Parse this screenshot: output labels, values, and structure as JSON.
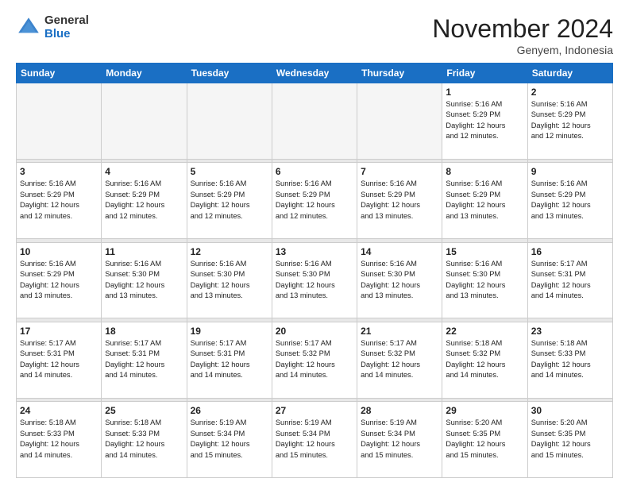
{
  "logo": {
    "general": "General",
    "blue": "Blue"
  },
  "title": "November 2024",
  "location": "Genyem, Indonesia",
  "weekdays": [
    "Sunday",
    "Monday",
    "Tuesday",
    "Wednesday",
    "Thursday",
    "Friday",
    "Saturday"
  ],
  "weeks": [
    [
      {
        "day": "",
        "info": ""
      },
      {
        "day": "",
        "info": ""
      },
      {
        "day": "",
        "info": ""
      },
      {
        "day": "",
        "info": ""
      },
      {
        "day": "",
        "info": ""
      },
      {
        "day": "1",
        "info": "Sunrise: 5:16 AM\nSunset: 5:29 PM\nDaylight: 12 hours\nand 12 minutes."
      },
      {
        "day": "2",
        "info": "Sunrise: 5:16 AM\nSunset: 5:29 PM\nDaylight: 12 hours\nand 12 minutes."
      }
    ],
    [
      {
        "day": "3",
        "info": "Sunrise: 5:16 AM\nSunset: 5:29 PM\nDaylight: 12 hours\nand 12 minutes."
      },
      {
        "day": "4",
        "info": "Sunrise: 5:16 AM\nSunset: 5:29 PM\nDaylight: 12 hours\nand 12 minutes."
      },
      {
        "day": "5",
        "info": "Sunrise: 5:16 AM\nSunset: 5:29 PM\nDaylight: 12 hours\nand 12 minutes."
      },
      {
        "day": "6",
        "info": "Sunrise: 5:16 AM\nSunset: 5:29 PM\nDaylight: 12 hours\nand 12 minutes."
      },
      {
        "day": "7",
        "info": "Sunrise: 5:16 AM\nSunset: 5:29 PM\nDaylight: 12 hours\nand 13 minutes."
      },
      {
        "day": "8",
        "info": "Sunrise: 5:16 AM\nSunset: 5:29 PM\nDaylight: 12 hours\nand 13 minutes."
      },
      {
        "day": "9",
        "info": "Sunrise: 5:16 AM\nSunset: 5:29 PM\nDaylight: 12 hours\nand 13 minutes."
      }
    ],
    [
      {
        "day": "10",
        "info": "Sunrise: 5:16 AM\nSunset: 5:29 PM\nDaylight: 12 hours\nand 13 minutes."
      },
      {
        "day": "11",
        "info": "Sunrise: 5:16 AM\nSunset: 5:30 PM\nDaylight: 12 hours\nand 13 minutes."
      },
      {
        "day": "12",
        "info": "Sunrise: 5:16 AM\nSunset: 5:30 PM\nDaylight: 12 hours\nand 13 minutes."
      },
      {
        "day": "13",
        "info": "Sunrise: 5:16 AM\nSunset: 5:30 PM\nDaylight: 12 hours\nand 13 minutes."
      },
      {
        "day": "14",
        "info": "Sunrise: 5:16 AM\nSunset: 5:30 PM\nDaylight: 12 hours\nand 13 minutes."
      },
      {
        "day": "15",
        "info": "Sunrise: 5:16 AM\nSunset: 5:30 PM\nDaylight: 12 hours\nand 13 minutes."
      },
      {
        "day": "16",
        "info": "Sunrise: 5:17 AM\nSunset: 5:31 PM\nDaylight: 12 hours\nand 14 minutes."
      }
    ],
    [
      {
        "day": "17",
        "info": "Sunrise: 5:17 AM\nSunset: 5:31 PM\nDaylight: 12 hours\nand 14 minutes."
      },
      {
        "day": "18",
        "info": "Sunrise: 5:17 AM\nSunset: 5:31 PM\nDaylight: 12 hours\nand 14 minutes."
      },
      {
        "day": "19",
        "info": "Sunrise: 5:17 AM\nSunset: 5:31 PM\nDaylight: 12 hours\nand 14 minutes."
      },
      {
        "day": "20",
        "info": "Sunrise: 5:17 AM\nSunset: 5:32 PM\nDaylight: 12 hours\nand 14 minutes."
      },
      {
        "day": "21",
        "info": "Sunrise: 5:17 AM\nSunset: 5:32 PM\nDaylight: 12 hours\nand 14 minutes."
      },
      {
        "day": "22",
        "info": "Sunrise: 5:18 AM\nSunset: 5:32 PM\nDaylight: 12 hours\nand 14 minutes."
      },
      {
        "day": "23",
        "info": "Sunrise: 5:18 AM\nSunset: 5:33 PM\nDaylight: 12 hours\nand 14 minutes."
      }
    ],
    [
      {
        "day": "24",
        "info": "Sunrise: 5:18 AM\nSunset: 5:33 PM\nDaylight: 12 hours\nand 14 minutes."
      },
      {
        "day": "25",
        "info": "Sunrise: 5:18 AM\nSunset: 5:33 PM\nDaylight: 12 hours\nand 14 minutes."
      },
      {
        "day": "26",
        "info": "Sunrise: 5:19 AM\nSunset: 5:34 PM\nDaylight: 12 hours\nand 15 minutes."
      },
      {
        "day": "27",
        "info": "Sunrise: 5:19 AM\nSunset: 5:34 PM\nDaylight: 12 hours\nand 15 minutes."
      },
      {
        "day": "28",
        "info": "Sunrise: 5:19 AM\nSunset: 5:34 PM\nDaylight: 12 hours\nand 15 minutes."
      },
      {
        "day": "29",
        "info": "Sunrise: 5:20 AM\nSunset: 5:35 PM\nDaylight: 12 hours\nand 15 minutes."
      },
      {
        "day": "30",
        "info": "Sunrise: 5:20 AM\nSunset: 5:35 PM\nDaylight: 12 hours\nand 15 minutes."
      }
    ]
  ]
}
